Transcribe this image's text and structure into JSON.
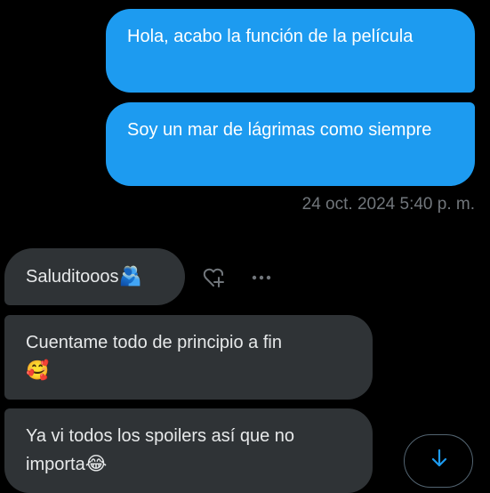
{
  "conversation": {
    "sent_messages": [
      {
        "text": "Hola, acabo la función de la película"
      },
      {
        "text": "Soy un mar de lágrimas como siempre"
      }
    ],
    "timestamp": "24 oct. 2024 5:40 p. m.",
    "received_messages": [
      {
        "text": "Saluditooos",
        "emoji": "🫂"
      },
      {
        "text": "Cuentame todo de principio a fin",
        "emoji": "🥰"
      },
      {
        "text": "Ya vi todos los spoilers así que no importa",
        "emoji": "😂"
      }
    ]
  },
  "icons": {
    "react": "add-reaction-icon",
    "more": "more-options-icon",
    "scroll": "arrow-down-icon"
  },
  "colors": {
    "background": "#000000",
    "sent_bubble": "#1d9bf0",
    "received_bubble": "#2f3336",
    "timestamp": "#71767b",
    "accent": "#1d9bf0"
  }
}
